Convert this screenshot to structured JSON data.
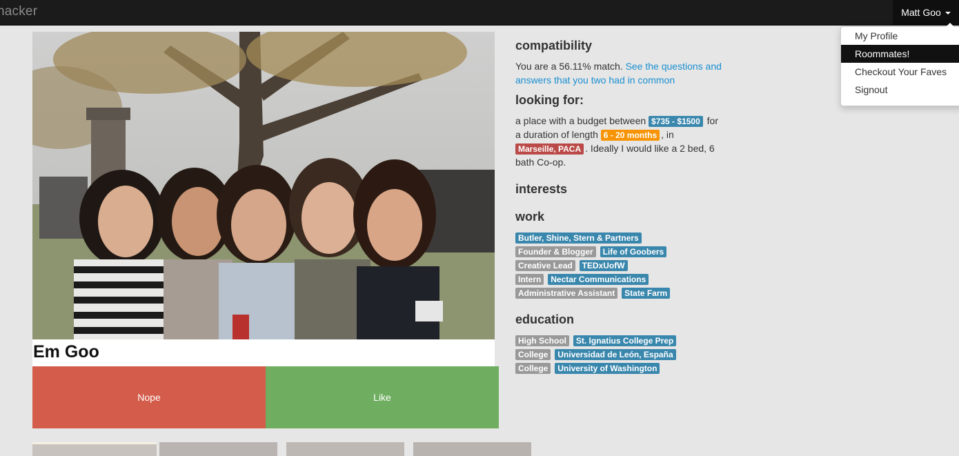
{
  "navbar": {
    "brand": "hacker",
    "user_name": "Matt Goo",
    "menu": [
      "My Profile",
      "Roommates!",
      "Checkout Your Faves",
      "Signout"
    ]
  },
  "profile": {
    "name": "Em Goo",
    "nope_label": "Nope",
    "like_label": "Like"
  },
  "compatibility": {
    "heading": "compatibility",
    "text": "You are a 56.11% match.",
    "link": "See the questions and answers that you two had in common"
  },
  "looking_for": {
    "heading": "looking for:",
    "budget_prefix": "a place with a budget between",
    "budget": "$735 - $1500",
    "duration_prefix": "for a duration of length",
    "duration": "6 - 20 months",
    "location_prefix": ", in",
    "location": "Marseille, PACA",
    "suffix": ". Ideally I would like a 2 bed, 6 bath Co-op."
  },
  "interests": {
    "heading": "interests"
  },
  "work": {
    "heading": "work",
    "rows": [
      {
        "role": "",
        "org": "Butler, Shine, Stern & Partners"
      },
      {
        "role": "Founder & Blogger",
        "org": "Life of Goobers"
      },
      {
        "role": "Creative Lead",
        "org": "TEDxUofW"
      },
      {
        "role": "Intern",
        "org": "Nectar Communications"
      },
      {
        "role": "Administrative Assistant",
        "org": "State Farm"
      }
    ]
  },
  "education": {
    "heading": "education",
    "rows": [
      {
        "level": "High School",
        "school": "St. Ignatius College Prep"
      },
      {
        "level": "College",
        "school": "Universidad de León, España"
      },
      {
        "level": "College",
        "school": "University of Washington"
      }
    ]
  },
  "colors": {
    "tag_blue": "#3a87ad",
    "tag_grey": "#999999",
    "tag_orange": "#f89406",
    "tag_red": "#b94a48",
    "nope": "#d35c4a",
    "like": "#6fae60"
  }
}
